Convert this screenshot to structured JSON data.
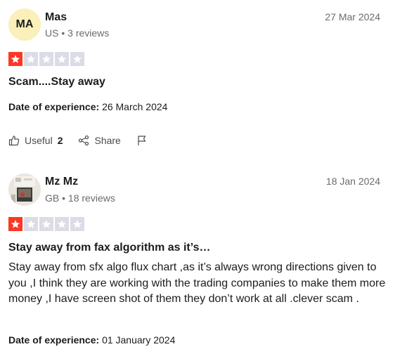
{
  "reviews": [
    {
      "initials": "MA",
      "name": "Mas",
      "country": "US",
      "review_count": "3 reviews",
      "date": "27 Mar 2024",
      "rating": 1,
      "title": "Scam....Stay away",
      "experience_label": "Date of experience:",
      "experience_date": "26 March 2024",
      "useful_label": "Useful",
      "useful_count": "2",
      "share_label": "Share"
    },
    {
      "name": "Mz Mz",
      "country": "GB",
      "review_count": "18 reviews",
      "date": "18 Jan 2024",
      "rating": 1,
      "title": "Stay away from fax algorithm as it’s…",
      "body": "Stay away from sfx algo flux chart ,as it’s always wrong directions given to you ,I think they are working with the trading companies to make them more money ,I have screen shot of them they don’t work at all .clever scam .",
      "experience_label": "Date of experience:",
      "experience_date": "01 January 2024"
    }
  ],
  "colors": {
    "star_on": "#ff3722",
    "star_off": "#dcdce6",
    "avatar_bg": "#fbefba"
  }
}
